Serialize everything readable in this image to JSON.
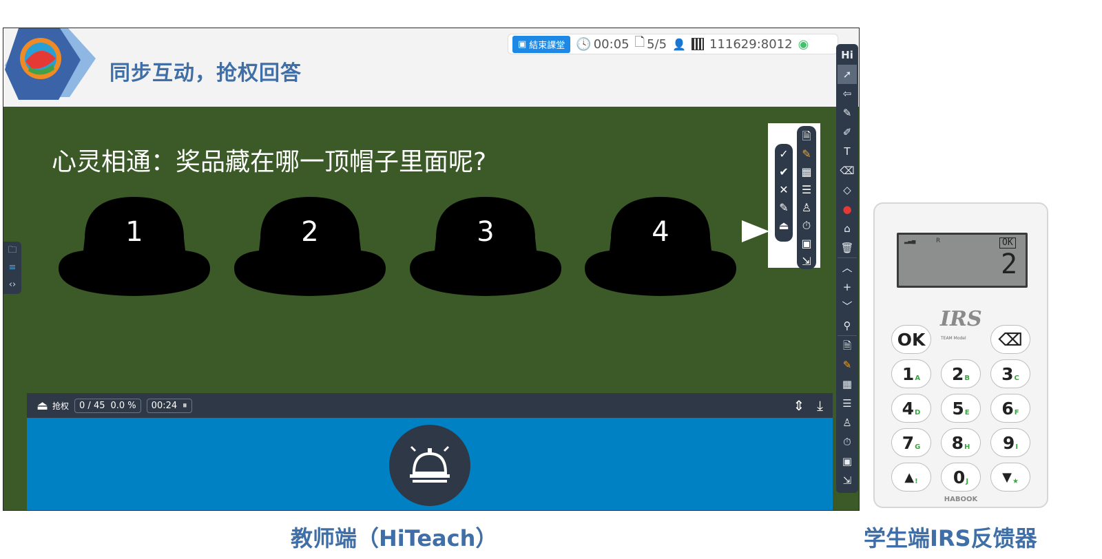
{
  "teacher": {
    "slide_title": "同步互动，抢权回答",
    "status": {
      "end_class": "結束課堂",
      "timer": "00:05",
      "page": "5/5",
      "session_code": "111629:8012"
    },
    "question": "心灵相通：奖品藏在哪一顶帽子里面呢?",
    "hats": [
      "1",
      "2",
      "3",
      "4"
    ],
    "answer_bar": {
      "title": "抢权",
      "count": "0 / 45",
      "percent": "0.0 %",
      "time": "00:24"
    },
    "toolbar_logo": "Hi",
    "colors": {
      "board": "#3b5a28",
      "panel": "#0081c4",
      "toolbar": "#2e3a4a",
      "accent": "#1e88e5",
      "title": "#3f6fa6"
    },
    "icons": [
      "pointer-icon",
      "undo-icon",
      "pencil-icon",
      "marker-icon",
      "text-icon",
      "eraser-icon",
      "fill-icon",
      "palette-icon",
      "stamp-icon",
      "trash-icon",
      "chevron-up-icon",
      "plus-icon",
      "chevron-down-icon",
      "search-icon"
    ]
  },
  "clicker": {
    "lcd_ok": "OK",
    "lcd_r": "R",
    "lcd_digit": "2",
    "brand": "IRS",
    "brand_sub": "TEAM Model",
    "maker": "HABOOK",
    "keys": [
      {
        "label": "OK",
        "sub": ""
      },
      {
        "label": "⌫",
        "sub": ""
      },
      {
        "label": "1",
        "sub": "A"
      },
      {
        "label": "2",
        "sub": "B"
      },
      {
        "label": "3",
        "sub": "C"
      },
      {
        "label": "4",
        "sub": "D"
      },
      {
        "label": "5",
        "sub": "E"
      },
      {
        "label": "6",
        "sub": "F"
      },
      {
        "label": "7",
        "sub": "G"
      },
      {
        "label": "8",
        "sub": "H"
      },
      {
        "label": "9",
        "sub": "I"
      },
      {
        "label": "▲",
        "sub": "!"
      },
      {
        "label": "0",
        "sub": "J"
      },
      {
        "label": "▼",
        "sub": "★"
      }
    ]
  },
  "captions": {
    "teacher": "教师端（HiTeach）",
    "student": "学生端IRS反馈器"
  }
}
